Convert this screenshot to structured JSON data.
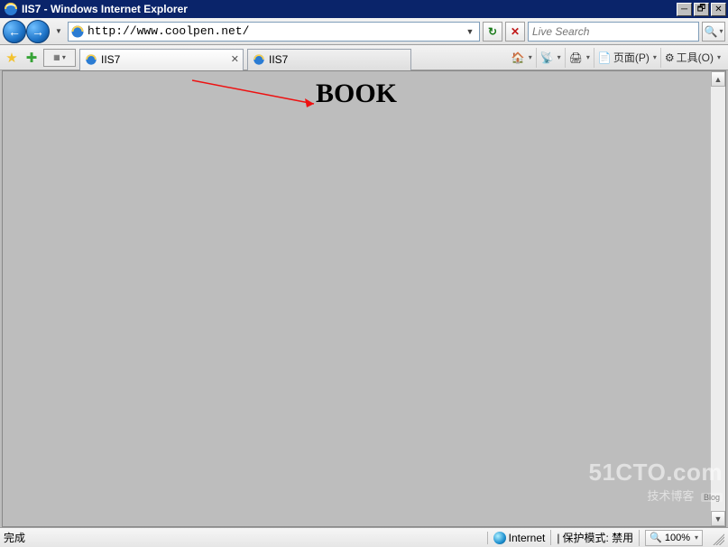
{
  "window": {
    "title": "IIS7 - Windows Internet Explorer"
  },
  "navbar": {
    "url": "http://www.coolpen.net/",
    "search_placeholder": "Live Search"
  },
  "tabs": [
    {
      "label": "IIS7",
      "active": true
    },
    {
      "label": "IIS7",
      "active": false
    }
  ],
  "commandbar": {
    "page_label": "页面(P)",
    "tools_label": "工具(O)"
  },
  "page": {
    "heading": "BOOK"
  },
  "statusbar": {
    "done": "完成",
    "zone": "Internet",
    "protected_mode": "保护模式: 禁用",
    "zoom": "100%"
  },
  "watermark": {
    "line1": "51CTO.com",
    "line2": "技术博客",
    "badge": "Blog"
  }
}
